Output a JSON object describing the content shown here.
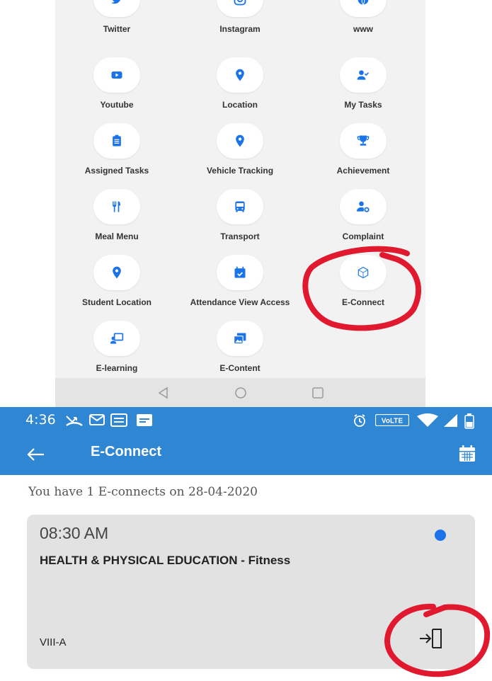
{
  "menu": {
    "items": [
      {
        "label": "Twitter",
        "icon": "twitter-icon"
      },
      {
        "label": "Instagram",
        "icon": "instagram-icon"
      },
      {
        "label": "www",
        "icon": "globe-icon"
      },
      {
        "label": "Youtube",
        "icon": "youtube-icon"
      },
      {
        "label": "Location",
        "icon": "location-pin-icon"
      },
      {
        "label": "My Tasks",
        "icon": "user-check-icon"
      },
      {
        "label": "Assigned Tasks",
        "icon": "clipboard-icon"
      },
      {
        "label": "Vehicle Tracking",
        "icon": "location-pin-icon"
      },
      {
        "label": "Achievement",
        "icon": "trophy-icon"
      },
      {
        "label": "Meal Menu",
        "icon": "utensils-icon"
      },
      {
        "label": "Transport",
        "icon": "bus-icon"
      },
      {
        "label": "Complaint",
        "icon": "user-cog-icon"
      },
      {
        "label": "Student Location",
        "icon": "location-pin-icon"
      },
      {
        "label": "Attendance View Access",
        "icon": "calendar-check-icon"
      },
      {
        "label": "E-Connect",
        "icon": "hexagon-icon"
      },
      {
        "label": "E-learning",
        "icon": "chalkboard-teacher-icon"
      },
      {
        "label": "E-Content",
        "icon": "images-icon"
      }
    ]
  },
  "status_bar": {
    "time": "4:36",
    "volte": "VoLTE"
  },
  "header": {
    "title": "E-Connect"
  },
  "summary": "You have 1 E-connects on 28-04-2020",
  "card": {
    "time": "08:30 AM",
    "subject": "HEALTH & PHYSICAL EDUCATION - Fitness",
    "class": "VIII-A"
  },
  "colors": {
    "primary": "#2f86d3",
    "icon_blue": "#1a73e8",
    "annotation_red": "#e0192f"
  }
}
